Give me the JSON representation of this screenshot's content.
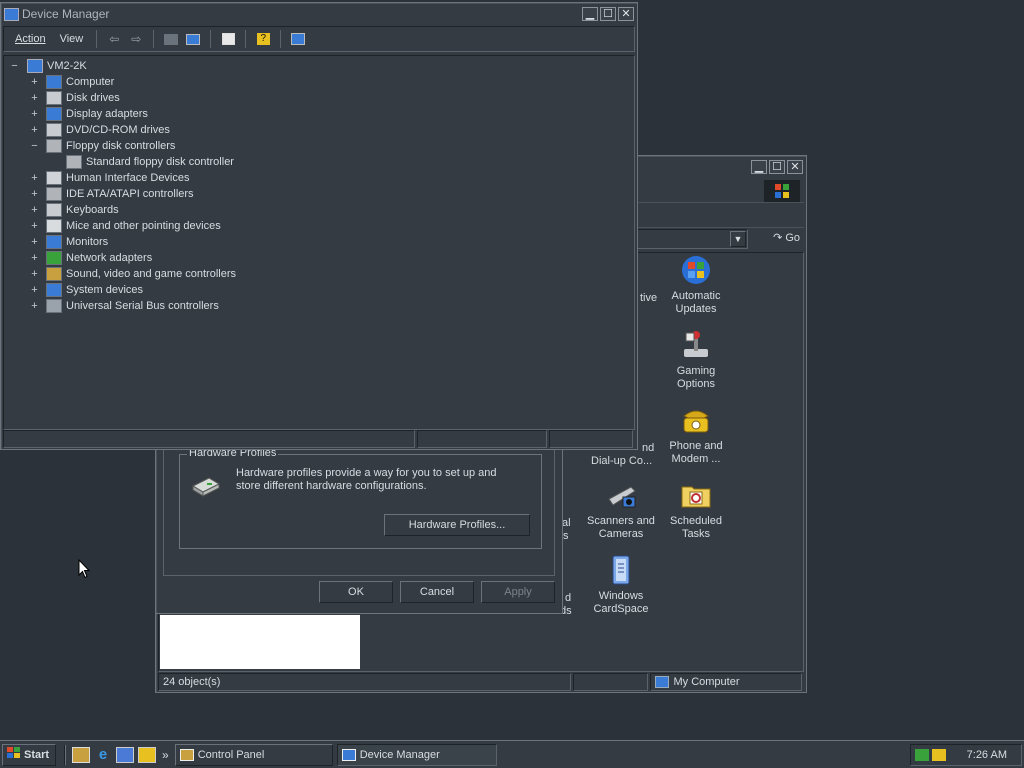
{
  "colors": {
    "desktop": "#2b3239",
    "window": "#343b42",
    "accent": "#3a7bd5",
    "white": "#ffffff"
  },
  "device_manager": {
    "title": "Device Manager",
    "menu": {
      "action": "Action",
      "view": "View"
    },
    "toolbar_icons": [
      "back-arrow-icon",
      "forward-arrow-icon",
      "folder-icon",
      "properties-pane-icon",
      "properties-icon",
      "help-icon",
      "scan-hardware-icon"
    ],
    "root": "VM2-2K",
    "nodes": [
      {
        "label": "Computer",
        "exp": "+",
        "icon": "computer-icon"
      },
      {
        "label": "Disk drives",
        "exp": "+",
        "icon": "disk-drive-icon"
      },
      {
        "label": "Display adapters",
        "exp": "+",
        "icon": "display-adapter-icon"
      },
      {
        "label": "DVD/CD-ROM drives",
        "exp": "+",
        "icon": "cdrom-icon"
      },
      {
        "label": "Floppy disk controllers",
        "exp": "−",
        "icon": "floppy-controller-icon"
      },
      {
        "label": "Standard floppy disk controller",
        "exp": "",
        "icon": "floppy-controller-icon",
        "child": true
      },
      {
        "label": "Human Interface Devices",
        "exp": "+",
        "icon": "hid-icon"
      },
      {
        "label": "IDE ATA/ATAPI controllers",
        "exp": "+",
        "icon": "ide-controller-icon"
      },
      {
        "label": "Keyboards",
        "exp": "+",
        "icon": "keyboard-icon"
      },
      {
        "label": "Mice and other pointing devices",
        "exp": "+",
        "icon": "mouse-icon"
      },
      {
        "label": "Monitors",
        "exp": "+",
        "icon": "monitor-icon"
      },
      {
        "label": "Network adapters",
        "exp": "+",
        "icon": "network-adapter-icon"
      },
      {
        "label": "Sound, video and game controllers",
        "exp": "+",
        "icon": "sound-icon"
      },
      {
        "label": "System devices",
        "exp": "+",
        "icon": "system-devices-icon"
      },
      {
        "label": "Universal Serial Bus controllers",
        "exp": "+",
        "icon": "usb-icon"
      }
    ]
  },
  "control_panel": {
    "go_label": "Go",
    "status": {
      "objects": "24 object(s)",
      "location": "My Computer"
    },
    "partial_labels": [
      "tive",
      "nd",
      "Dial-up Co...",
      "al",
      "s",
      "d",
      "ds"
    ],
    "icons": [
      {
        "name": "automatic-updates",
        "label1": "Automatic",
        "label2": "Updates"
      },
      {
        "name": "gaming-options",
        "label1": "Gaming",
        "label2": "Options"
      },
      {
        "name": "phone-modem",
        "label1": "Phone and",
        "label2": "Modem ..."
      },
      {
        "name": "scanners-cameras",
        "label1": "Scanners and",
        "label2": "Cameras"
      },
      {
        "name": "scheduled-tasks",
        "label1": "Scheduled",
        "label2": "Tasks"
      },
      {
        "name": "windows-cardspace",
        "label1": "Windows",
        "label2": "CardSpace"
      }
    ]
  },
  "system_props": {
    "group_title": "Hardware Profiles",
    "description": "Hardware profiles provide a way for you to set up and store different hardware configurations.",
    "profiles_button": "Hardware Profiles...",
    "ok": "OK",
    "cancel": "Cancel",
    "apply": "Apply"
  },
  "taskbar": {
    "start": "Start",
    "chevron": "»",
    "tasks": [
      "Control Panel",
      "Device Manager"
    ],
    "time": "7:26 AM"
  }
}
